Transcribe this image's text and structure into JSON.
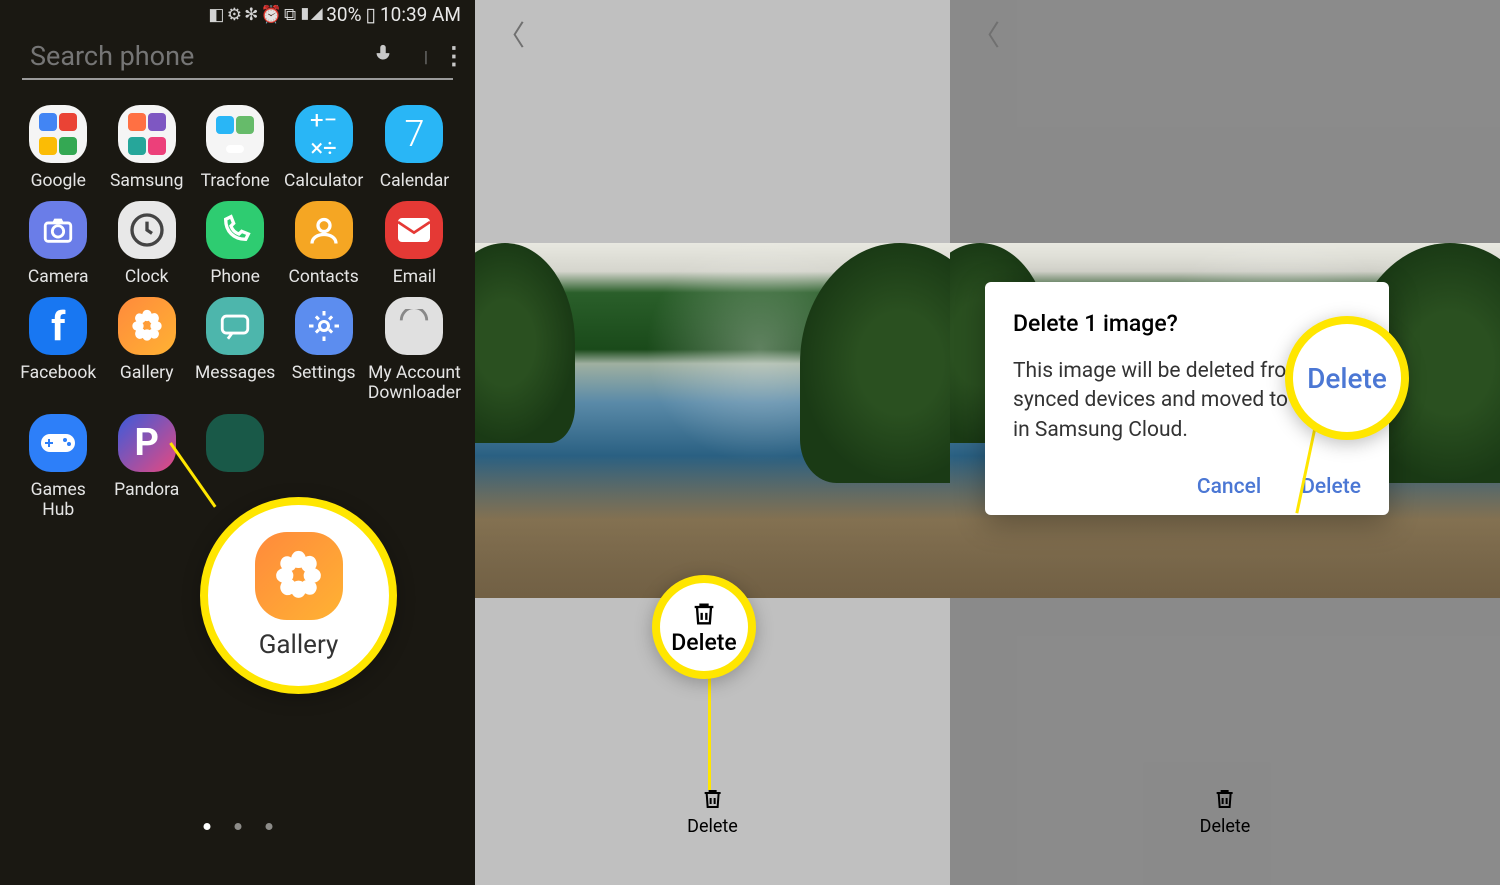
{
  "status": {
    "icons": "◧ ⚙ ✻ ⏰ ⧉ ▮◢",
    "battery_pct": "30%",
    "time": "10:39 AM"
  },
  "search": {
    "placeholder": "Search phone"
  },
  "apps": {
    "row1": [
      {
        "label": "Google",
        "type": "folder"
      },
      {
        "label": "Samsung",
        "type": "folder2"
      },
      {
        "label": "Tracfone",
        "type": "folder3"
      },
      {
        "label": "Calculator"
      },
      {
        "label": "Calendar"
      }
    ],
    "row2": [
      {
        "label": "Camera"
      },
      {
        "label": "Clock"
      },
      {
        "label": "Phone"
      },
      {
        "label": "Contacts"
      },
      {
        "label": "Email"
      }
    ],
    "row3": [
      {
        "label": "Facebook"
      },
      {
        "label": "Gallery"
      },
      {
        "label": "Messages"
      },
      {
        "label": "Settings"
      },
      {
        "label": "My Account Downloader"
      }
    ],
    "row4": [
      {
        "label": "Games Hub"
      },
      {
        "label": "Pandora"
      }
    ]
  },
  "callouts": {
    "gallery_label": "Gallery",
    "delete_btn_label": "Delete",
    "delete_dlg_label": "Delete"
  },
  "screen2": {
    "delete_label": "Delete"
  },
  "screen3": {
    "delete_label": "Delete"
  },
  "dialog": {
    "title": "Delete 1 image?",
    "body": "This image will be deleted from your synced devices and moved to Trash in Samsung Cloud.",
    "cancel": "Cancel",
    "delete": "Delete"
  }
}
